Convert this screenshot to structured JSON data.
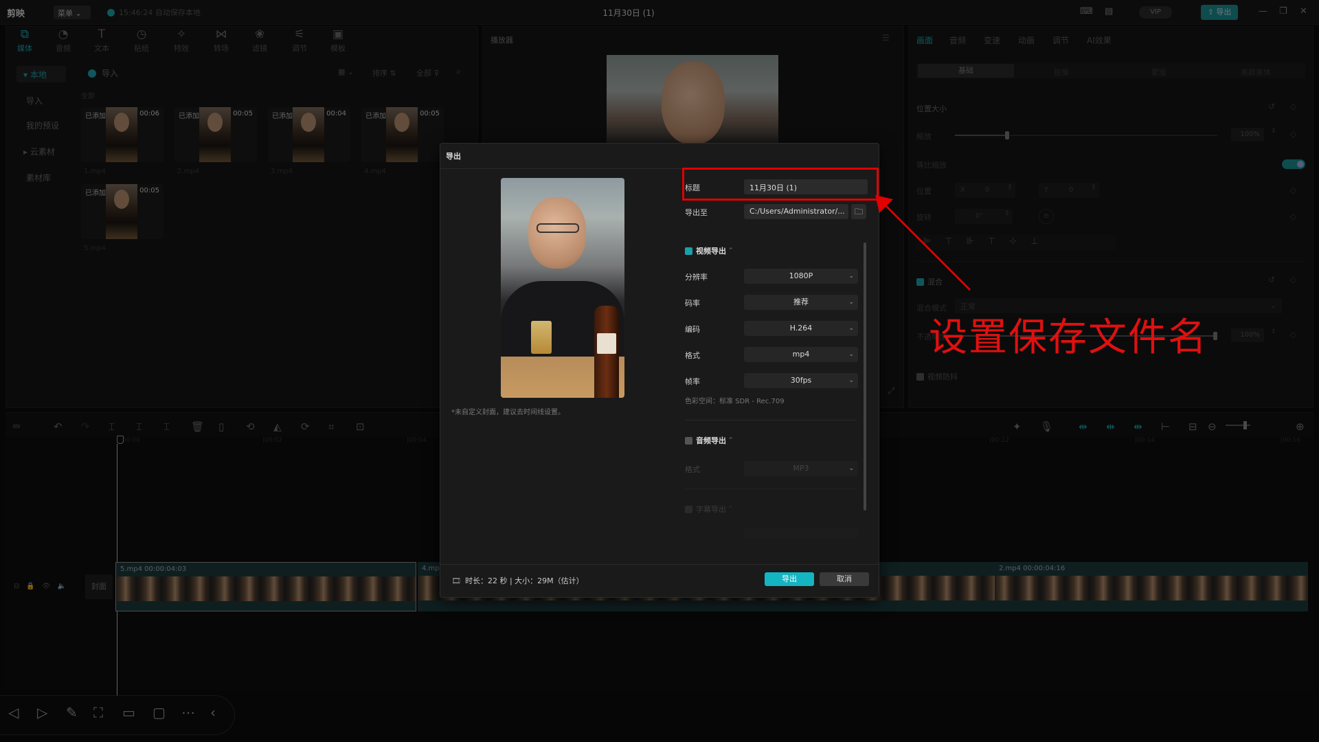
{
  "app": {
    "logo": "剪映",
    "menu_label": "菜单",
    "autosave_text": "15:46:24 自动保存本地",
    "project_title": "11月30日 (1)",
    "vip_label": "VIP",
    "export_label": "导出"
  },
  "toolbar": {
    "items": [
      {
        "icon": "media-icon",
        "label": "媒体"
      },
      {
        "icon": "audio-icon",
        "label": "音频"
      },
      {
        "icon": "text-icon",
        "label": "文本"
      },
      {
        "icon": "sticker-icon",
        "label": "贴纸"
      },
      {
        "icon": "effects-icon",
        "label": "特效"
      },
      {
        "icon": "transition-icon",
        "label": "转场"
      },
      {
        "icon": "filter-icon",
        "label": "滤镜"
      },
      {
        "icon": "adjust-icon",
        "label": "调节"
      },
      {
        "icon": "template-icon",
        "label": "模板"
      }
    ]
  },
  "media_sidebar": {
    "items": [
      "▾ 本地",
      "导入",
      "我的预设",
      "▸ 云素材",
      "素材库"
    ]
  },
  "media_panel": {
    "import_label": "导入",
    "sort_label": "排序",
    "filter_label": "全部",
    "section_label": "全部",
    "clips": [
      {
        "tag": "已添加",
        "duration": "00:06",
        "name": "1.mp4"
      },
      {
        "tag": "已添加",
        "duration": "00:05",
        "name": "2.mp4"
      },
      {
        "tag": "已添加",
        "duration": "00:04",
        "name": "3.mp4"
      },
      {
        "tag": "已添加",
        "duration": "00:05",
        "name": "4.mp4"
      },
      {
        "tag": "已添加",
        "duration": "00:05",
        "name": "5.mp4"
      }
    ]
  },
  "player": {
    "title": "播放器"
  },
  "inspector": {
    "tabs": [
      "画面",
      "音频",
      "变速",
      "动画",
      "调节",
      "AI效果"
    ],
    "subtabs": [
      "基础",
      "抠像",
      "蒙版",
      "美颜美体"
    ],
    "position_size": "位置大小",
    "scale_label": "缩放",
    "scale_value": "100%",
    "uniform_scale": "等比缩放",
    "position_label": "位置",
    "pos_x_label": "X",
    "pos_x": "0",
    "pos_y_label": "Y",
    "pos_y": "0",
    "rotate_label": "旋转",
    "rotate_value": "0°",
    "blend_label": "混合",
    "blend_mode_label": "混合模式",
    "blend_mode_value": "正常",
    "opacity_label": "不透明度",
    "opacity_value": "100%",
    "stabilize_label": "视频防抖",
    "scale_level": 0.2,
    "opacity_level": 1.0
  },
  "timeline": {
    "ruler": [
      "00:00",
      "|00:02",
      "|00:04",
      "|00:12",
      "|00:14",
      "|00:16"
    ],
    "cover_label": "封面",
    "clips": [
      {
        "label": "5.mp4  00:00:04:03"
      },
      {
        "label": "4.mp4"
      },
      {
        "label": "2.mp4  00:00:04:16"
      }
    ]
  },
  "export_dialog": {
    "title": "导出",
    "cover_note": "*未自定义封面，建议去时间线设置。",
    "name_label": "标题",
    "name_value": "11月30日 (1)",
    "path_label": "导出至",
    "path_value": "C:/Users/Administrator/...",
    "video_section": "视频导出",
    "resolution_label": "分辨率",
    "resolution_value": "1080P",
    "bitrate_label": "码率",
    "bitrate_value": "推荐",
    "codec_label": "编码",
    "codec_value": "H.264",
    "format_label": "格式",
    "format_value": "mp4",
    "fps_label": "帧率",
    "fps_value": "30fps",
    "colorspace": "色彩空间：标准 SDR - Rec.709",
    "audio_section": "音频导出",
    "audio_format_label": "格式",
    "audio_format_value": "MP3",
    "subtitle_section": "字幕导出",
    "summary": "时长：22 秒 | 大小：29M（估计）",
    "export_button": "导出",
    "cancel_button": "取消"
  },
  "annotation": {
    "text": "设置保存文件名",
    "color": "#e00000"
  },
  "colors": {
    "accent": "#1aa0a8",
    "export_button": "#15b4c2",
    "annotation_red": "#e00000"
  }
}
